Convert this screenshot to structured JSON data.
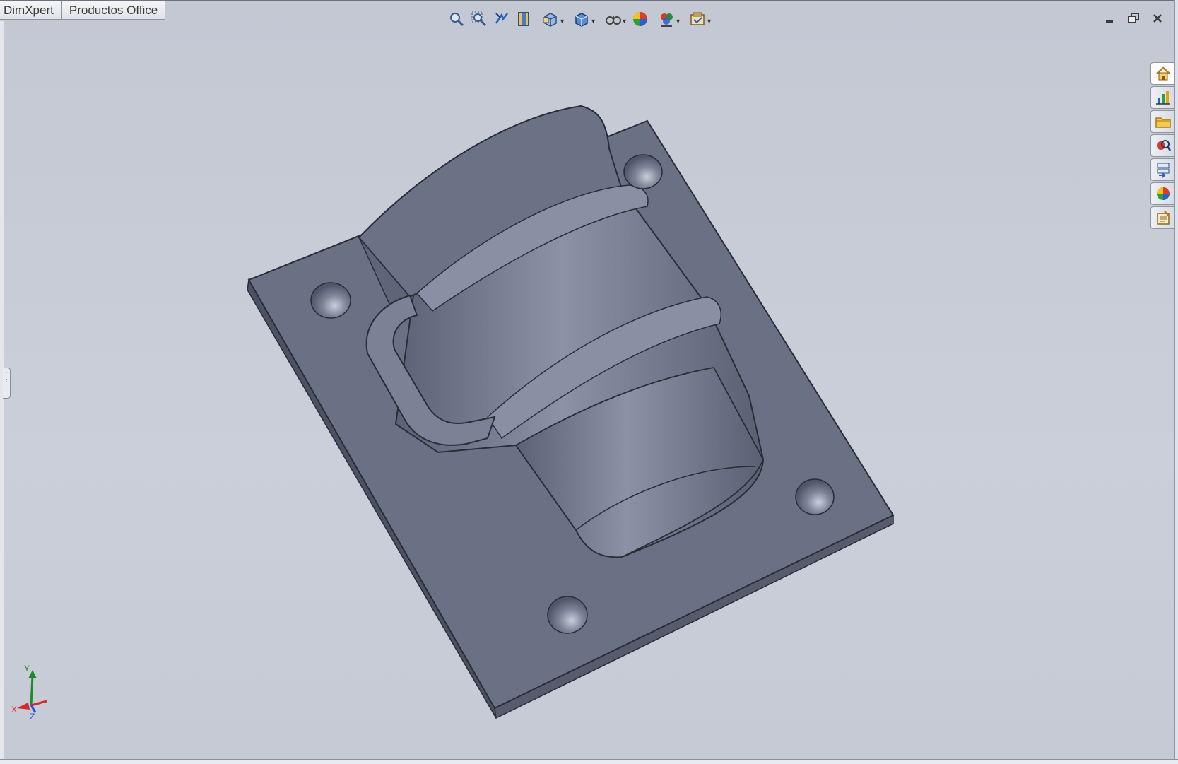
{
  "tabs": [
    "DimXpert",
    "Productos Office"
  ],
  "view_toolbar": [
    {
      "icon": "zoom-to-fit-icon",
      "has_menu": false
    },
    {
      "icon": "zoom-to-area-icon",
      "has_menu": false
    },
    {
      "icon": "previous-view-icon",
      "has_menu": false
    },
    {
      "icon": "section-view-icon",
      "has_menu": false
    },
    {
      "icon": "view-orientation-icon",
      "has_menu": true
    },
    {
      "icon": "display-style-icon",
      "has_menu": true
    },
    {
      "icon": "hide-show-items-icon",
      "has_menu": true
    },
    {
      "icon": "edit-appearance-icon",
      "has_menu": false
    },
    {
      "icon": "apply-scene-icon",
      "has_menu": true
    },
    {
      "icon": "view-settings-icon",
      "has_menu": true
    }
  ],
  "window_controls": [
    "minimize-icon",
    "restore-icon",
    "close-icon"
  ],
  "task_pane": [
    {
      "icon": "home-icon"
    },
    {
      "icon": "resources-icon"
    },
    {
      "icon": "file-explorer-icon"
    },
    {
      "icon": "search-icon"
    },
    {
      "icon": "view-palette-icon"
    },
    {
      "icon": "appearances-icon"
    },
    {
      "icon": "custom-properties-icon"
    }
  ],
  "triad": {
    "x_label": "X",
    "y_label": "Y",
    "z_label": "Z"
  },
  "colors": {
    "background": "#c6cad4",
    "part_face": "#6c7286",
    "part_dark": "#4f5466",
    "part_light": "#8f95a8"
  }
}
